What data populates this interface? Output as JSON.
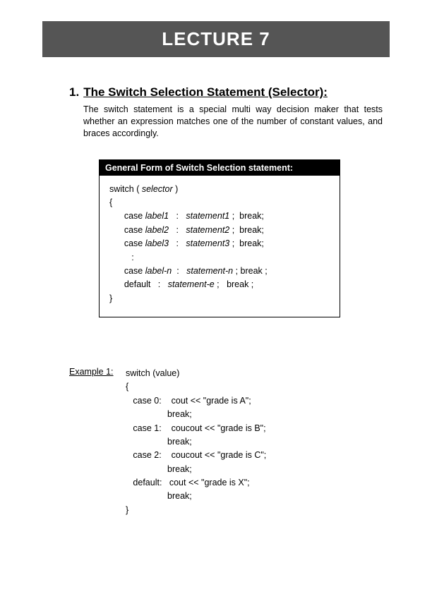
{
  "lecture_title": "LECTURE  7",
  "section": {
    "number": "1.",
    "title": "The Switch Selection Statement (Selector):",
    "body": "The switch statement is a special multi way decision maker that tests whether an expression matches one of the number of constant values, and braces accordingly."
  },
  "form_box": {
    "header": "General Form of Switch Selection statement:",
    "lines": [
      {
        "text": "switch ( ",
        "italic_after": "selector",
        "tail": " )"
      },
      {
        "text": "{"
      },
      {
        "prefix": "      case ",
        "label": "label1",
        "mid": "   :   ",
        "stmt": "statement1",
        "suffix": " ;  break;"
      },
      {
        "prefix": "      case ",
        "label": "label2",
        "mid": "   :   ",
        "stmt": "statement2",
        "suffix": " ;  break;"
      },
      {
        "prefix": "      case ",
        "label": "label3",
        "mid": "   :   ",
        "stmt": "statement3",
        "suffix": " ;  break;"
      },
      {
        "text": "         :"
      },
      {
        "prefix": "      case ",
        "label": "label-n",
        "mid": "  :   ",
        "stmt": "statement-n",
        "suffix": " ; break ;"
      },
      {
        "prefix": "      default   :   ",
        "stmt": "statement-e",
        "suffix": " ;   break ;"
      },
      {
        "text": "}"
      }
    ]
  },
  "example": {
    "label": "Example 1:",
    "code": "switch (value)\n{\n   case 0:    cout << \"grade is A\";\n                 break;\n   case 1:    coucout << \"grade is B\";\n                 break;\n   case 2:    coucout << \"grade is C\";\n                 break;\n   default:   cout << \"grade is X\";\n                 break;\n}"
  }
}
